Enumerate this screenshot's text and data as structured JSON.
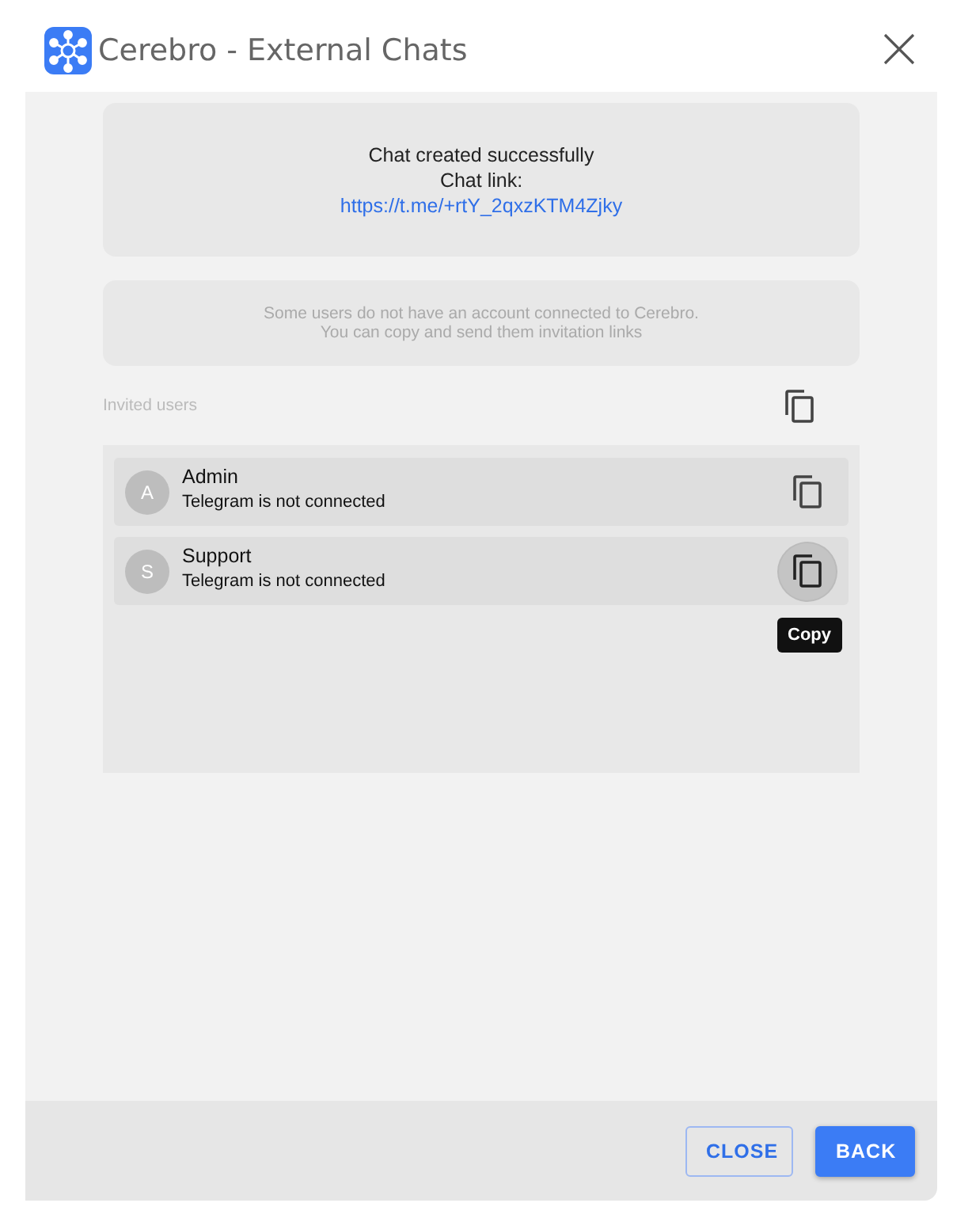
{
  "window": {
    "title": "Cerebro - External Chats"
  },
  "success": {
    "message": "Chat created successfully",
    "link_label": "Chat link:",
    "link": "https://t.me/+rtY_2qxzKTM4Zjky"
  },
  "notice": [
    "Some users do not have an account connected to Cerebro.",
    "You can copy and send them invitation links"
  ],
  "invited": {
    "label": "Invited users",
    "users": [
      {
        "initial": "A",
        "name": "Admin",
        "status": "Telegram is not connected",
        "hovered": false
      },
      {
        "initial": "S",
        "name": "Support",
        "status": "Telegram is not connected",
        "hovered": true,
        "tooltip": "Copy"
      }
    ]
  },
  "buttons": [
    {
      "label": "CLOSE",
      "kind": "outlined"
    },
    {
      "label": "BACK",
      "kind": "contained"
    }
  ]
}
